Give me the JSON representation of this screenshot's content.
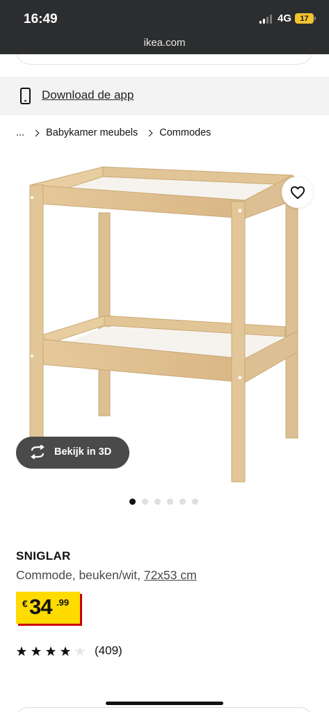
{
  "status_bar": {
    "time": "16:49",
    "network": "4G",
    "battery": "17",
    "battery_color": "#f2c230"
  },
  "browser": {
    "url": "ikea.com"
  },
  "app_banner": {
    "icon": "smartphone-icon",
    "link_text": "Download de app"
  },
  "breadcrumb": {
    "items": [
      "...",
      "Babykamer meubels",
      "Commodes"
    ]
  },
  "product_image": {
    "favorite_icon": "heart-icon",
    "view_3d_icon": "rotate-3d-icon",
    "view_3d_label": "Bekijk in 3D",
    "image_count": 6,
    "active_image": 1
  },
  "product": {
    "name": "SNIGLAR",
    "description": "Commode, beuken/wit, ",
    "size": "72x53 cm",
    "price_currency": "€",
    "price_integer": "34",
    "price_decimal": ".99",
    "price_bg_color": "#ffdb00",
    "price_shadow_color": "#cc0008",
    "rating_stars": 4,
    "rating_max": 5,
    "review_count": "(409)"
  }
}
